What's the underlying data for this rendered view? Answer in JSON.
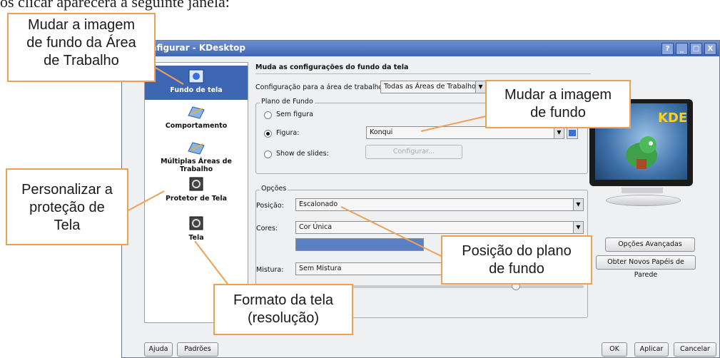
{
  "page_text": "os clicar aparecerá a seguinte janela:",
  "window": {
    "title": "nfigurar - KDesktop",
    "buttons": [
      "?",
      "_",
      "□",
      "X"
    ]
  },
  "sidebar": {
    "items": [
      {
        "label": "Fundo de tela",
        "icon": "wallpaper-icon",
        "active": true
      },
      {
        "label": "Comportamento",
        "icon": "pencil-desktop-icon"
      },
      {
        "label": "Múltiplas Áreas de Trabalho",
        "icon": "desktops-icon"
      },
      {
        "label": "Protetor de Tela",
        "icon": "screensaver-icon"
      },
      {
        "label": "Tela",
        "icon": "display-icon"
      }
    ]
  },
  "main": {
    "heading": "Muda as configurações do fundo da tela",
    "config_label": "Configuração para a área de trabalho:",
    "config_value": "Todas as Áreas de Trabalho",
    "plano_group_title": "Plano de Fundo",
    "radio_sem": "Sem figura",
    "radio_figura": "Figura:",
    "figura_value": "Konqui",
    "radio_slides": "Show de slides:",
    "configurar_label": "Configurar...",
    "opcoes_group_title": "Opções",
    "posicao_label": "Posição:",
    "posicao_value": "Escalonado",
    "cores_label": "Cores:",
    "cores_value": "Cor Única",
    "color_swatch": "#5a7fc4",
    "mistura_label": "Mistura:",
    "mistura_value": "Sem Mistura",
    "opcoes_avancadas": "Opções Avançadas",
    "obter_papeis": "Obter Novos Papéis de Parede"
  },
  "footer": {
    "ajuda": "Ajuda",
    "padroes": "Padrões",
    "ok": "OK",
    "aplicar": "Aplicar",
    "cancelar": "Cancelar"
  },
  "preview": {
    "logo_text": "KDE"
  },
  "callouts": {
    "mudar_area": [
      "Mudar a imagem",
      "de fundo da Área",
      "de Trabalho"
    ],
    "mudar_fundo": [
      "Mudar a imagem",
      "de fundo"
    ],
    "personalizar": [
      "Personalizar a",
      "proteção de",
      "Tela"
    ],
    "posicao": [
      "Posição do plano",
      "de fundo"
    ],
    "formato": [
      "Formato da tela",
      "(resolução)"
    ]
  },
  "accent_colors": {
    "callout_border": "#f0a056",
    "title_bar": "#3c66b8",
    "selection": "#3d66b3"
  }
}
